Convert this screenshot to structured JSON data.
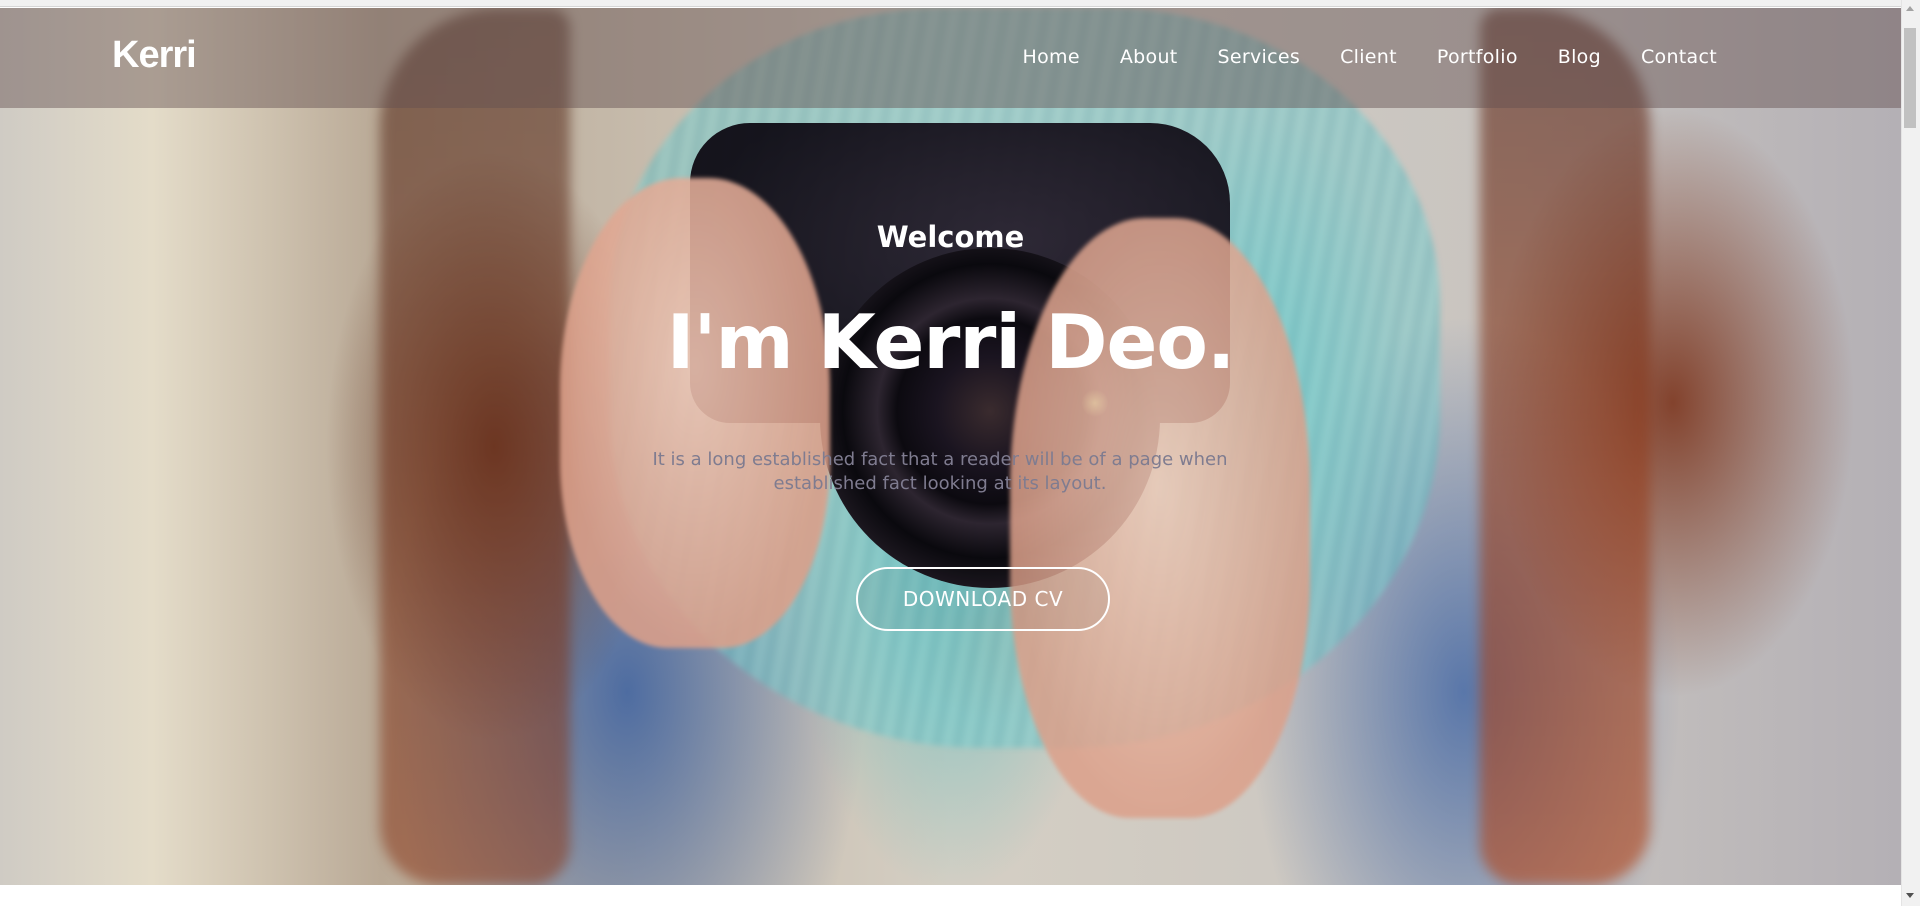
{
  "header": {
    "logo": "Kerri",
    "nav": [
      "Home",
      "About",
      "Services",
      "Client",
      "Portfolio",
      "Blog",
      "Contact"
    ]
  },
  "hero": {
    "welcome": "Welcome",
    "headline": "I'm Kerri Deo.",
    "subtext": "It is a long established fact that a reader will be of a page when established fact looking at its layout.",
    "button_label": "DOWNLOAD CV",
    "background_description_icon": "camera-photo-background"
  },
  "colors": {
    "nav_overlay": "#645050",
    "text": "#ffffff",
    "subtext": "#7f7c90"
  }
}
